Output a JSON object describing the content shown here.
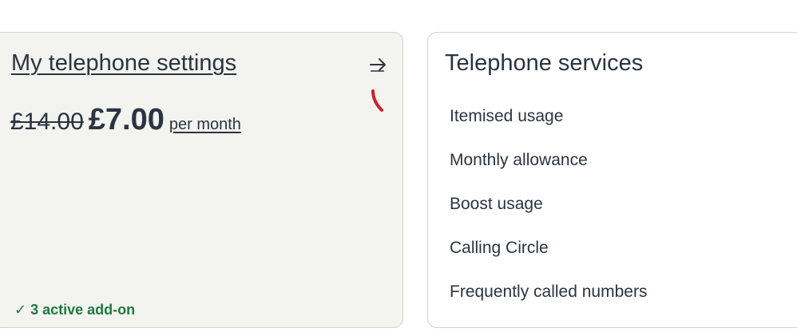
{
  "settings_card": {
    "title": "My telephone settings",
    "old_price": "£14.00",
    "new_price": "£7.00",
    "price_suffix": "per month",
    "addons_label": "3 active add-on",
    "arrow_icon": "arrow-right-icon",
    "check_icon": "checkmark-icon",
    "accent_color": "#1f7a3e"
  },
  "services_card": {
    "title": "Telephone services",
    "items": [
      {
        "label": "Itemised usage"
      },
      {
        "label": "Monthly allowance"
      },
      {
        "label": "Boost usage"
      },
      {
        "label": "Calling Circle"
      },
      {
        "label": "Frequently called numbers"
      }
    ]
  }
}
